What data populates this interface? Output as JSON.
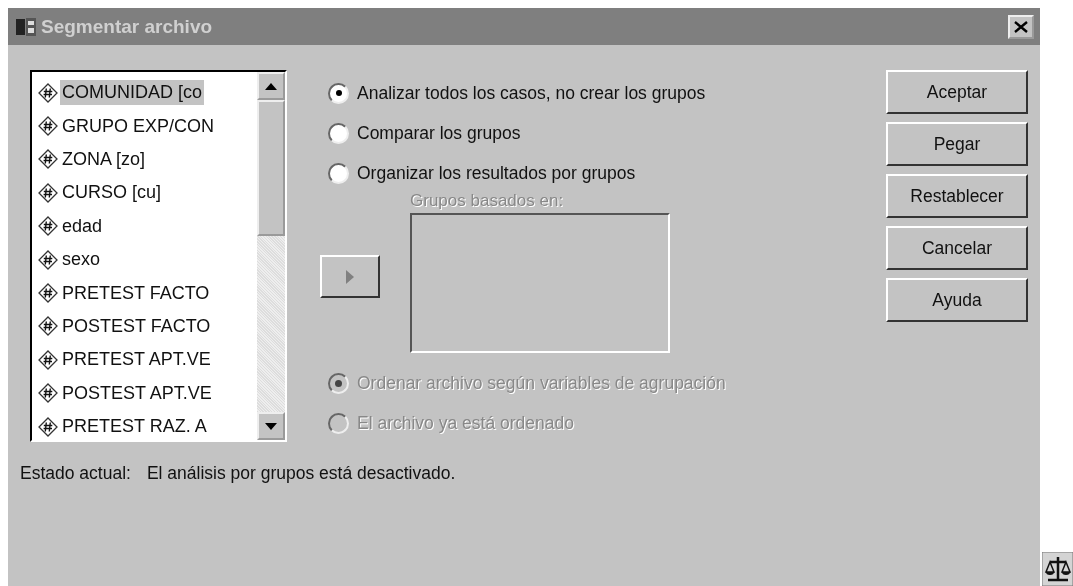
{
  "window": {
    "title": "Segmentar archivo"
  },
  "variables": [
    {
      "label": "COMUNIDAD [co",
      "selected": true
    },
    {
      "label": "GRUPO EXP/CON",
      "selected": false
    },
    {
      "label": "ZONA [zo]",
      "selected": false
    },
    {
      "label": "CURSO [cu]",
      "selected": false
    },
    {
      "label": "edad",
      "selected": false
    },
    {
      "label": "sexo",
      "selected": false
    },
    {
      "label": "PRETEST FACTO",
      "selected": false
    },
    {
      "label": "POSTEST FACTO",
      "selected": false
    },
    {
      "label": "PRETEST APT.VE",
      "selected": false
    },
    {
      "label": "POSTEST APT.VE",
      "selected": false
    },
    {
      "label": "PRETEST RAZ. A",
      "selected": false
    }
  ],
  "analysis_options": [
    {
      "label": "Analizar todos los casos, no crear los grupos",
      "selected": true,
      "disabled": false
    },
    {
      "label": "Comparar los grupos",
      "selected": false,
      "disabled": false
    },
    {
      "label": "Organizar los resultados por grupos",
      "selected": false,
      "disabled": false
    }
  ],
  "groups_box": {
    "label": "Grupos basados en:",
    "disabled": true
  },
  "sort_options": [
    {
      "label": "Ordenar archivo según variables de agrupación",
      "selected": true,
      "disabled": true
    },
    {
      "label": "El archivo ya está ordenado",
      "selected": false,
      "disabled": true
    }
  ],
  "buttons": [
    "Aceptar",
    "Pegar",
    "Restablecer",
    "Cancelar",
    "Ayuda"
  ],
  "status": {
    "label": "Estado actual:",
    "value": "El análisis por grupos está desactivado."
  }
}
